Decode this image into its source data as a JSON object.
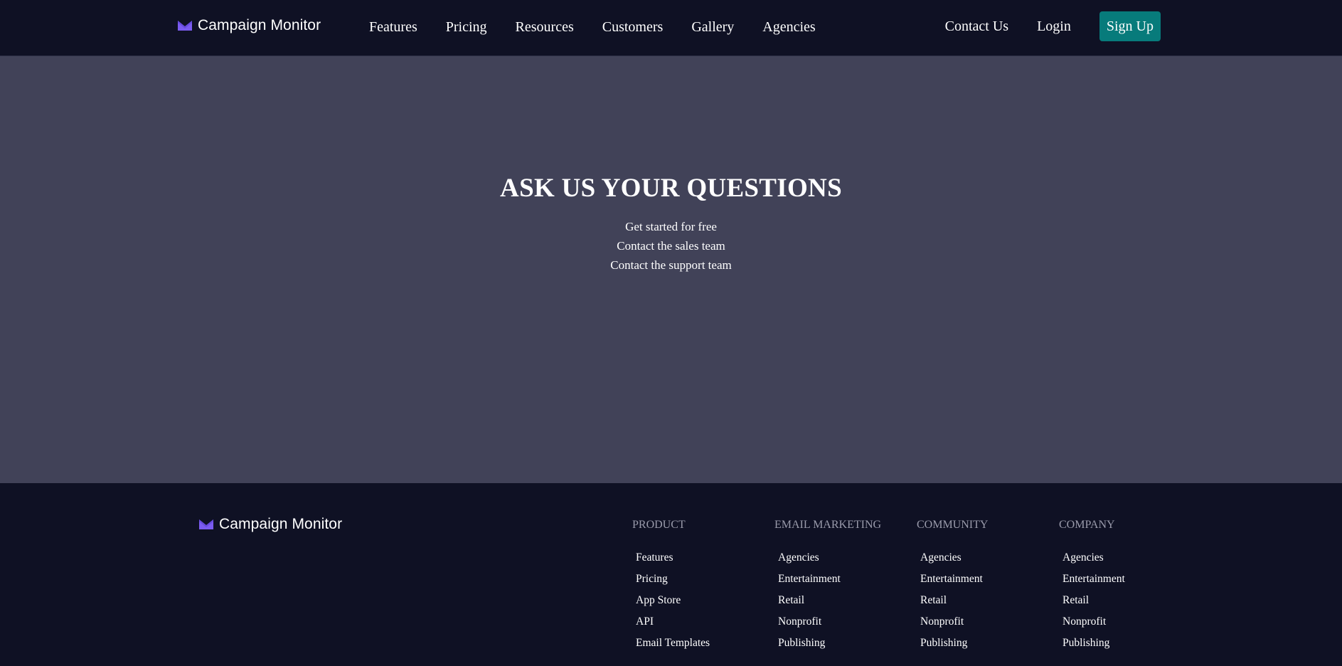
{
  "brand": {
    "name": "Campaign Monitor",
    "logo_icon": "envelope-m-icon",
    "accent": "#7b5cf0"
  },
  "header": {
    "nav": [
      "Features",
      "Pricing",
      "Resources",
      "Customers",
      "Gallery",
      "Agencies"
    ],
    "contact_label": "Contact Us",
    "login_label": "Login",
    "signup_label": "Sign Up",
    "signup_color": "#077b7b"
  },
  "hero": {
    "title": "ASK US YOUR QUESTIONS",
    "links": [
      "Get started for free",
      "Contact the sales team",
      "Contact the support team"
    ],
    "background": "#414258"
  },
  "footer": {
    "columns": [
      {
        "heading": "PRODUCT",
        "items": [
          "Features",
          "Pricing",
          "App Store",
          "API",
          "Email Templates"
        ]
      },
      {
        "heading": "EMAIL MARKETING",
        "items": [
          "Agencies",
          "Entertainment",
          "Retail",
          "Nonprofit",
          "Publishing"
        ]
      },
      {
        "heading": "COMMUNITY",
        "items": [
          "Agencies",
          "Entertainment",
          "Retail",
          "Nonprofit",
          "Publishing"
        ]
      },
      {
        "heading": "COMPANY",
        "items": [
          "Agencies",
          "Entertainment",
          "Retail",
          "Nonprofit",
          "Publishing"
        ]
      }
    ]
  }
}
